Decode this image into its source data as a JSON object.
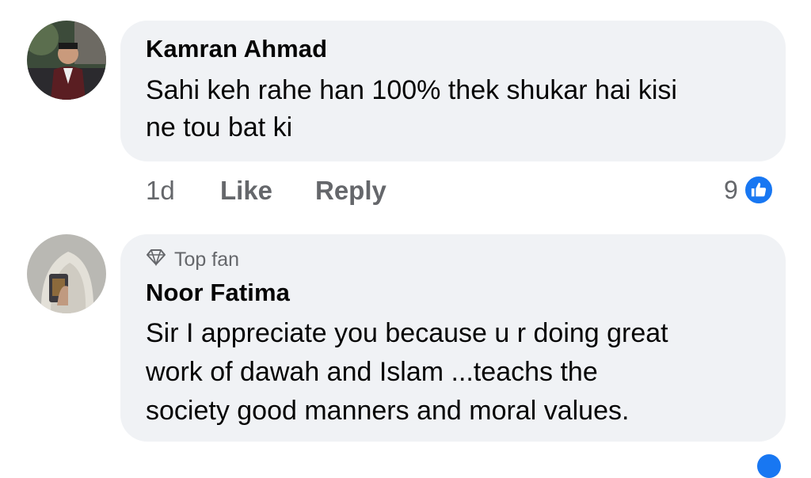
{
  "comments": [
    {
      "author": "Kamran Ahmad",
      "lines": [
        "Sahi keh rahe han 100% thek shukar hai kisi",
        "ne tou bat ki"
      ],
      "time": "1d",
      "like_label": "Like",
      "reply_label": "Reply",
      "reaction_count": "9",
      "reaction_icon": "thumbs-up-icon"
    },
    {
      "badge_icon": "diamond-icon",
      "badge": "Top fan",
      "author": "Noor Fatima",
      "lines": [
        "Sir I appreciate you because u r doing great",
        "work of dawah and Islam ...teachs the",
        "society good manners and moral values."
      ]
    }
  ],
  "colors": {
    "bubble": "#f0f2f5",
    "secondary_text": "#65676b",
    "like_blue": "#1877f2"
  }
}
